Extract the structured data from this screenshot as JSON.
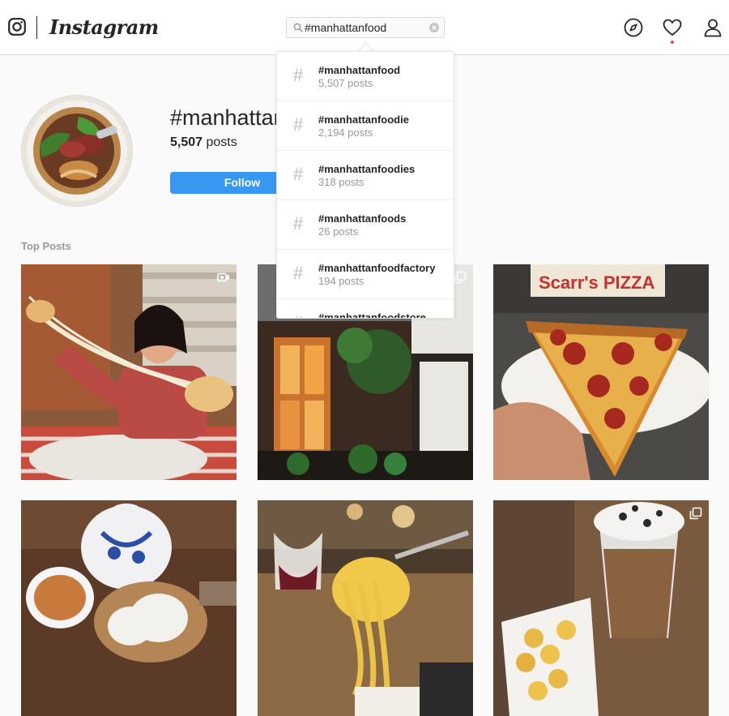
{
  "nav": {
    "wordmark": "Instagram",
    "search_value": "#manhattanfood",
    "icons": [
      "instagram-logo-icon",
      "search-icon",
      "clear-icon",
      "explore-compass-icon",
      "activity-heart-icon",
      "profile-person-icon"
    ],
    "notification_dot_color": "#ed4956"
  },
  "header": {
    "title": "#manhattanfood",
    "post_count": "5,507",
    "post_count_label": "posts",
    "follow_label": "Follow"
  },
  "section": {
    "top_posts_label": "Top Posts"
  },
  "search_results": [
    {
      "tag": "#manhattanfood",
      "count": "5,507 posts"
    },
    {
      "tag": "#manhattanfoodie",
      "count": "2,194 posts"
    },
    {
      "tag": "#manhattanfoodies",
      "count": "318 posts"
    },
    {
      "tag": "#manhattanfoods",
      "count": "26 posts"
    },
    {
      "tag": "#manhattanfoodfactory",
      "count": "194 posts"
    },
    {
      "tag": "#manhattanfoodstore",
      "count": ""
    }
  ],
  "hash_symbol": "#",
  "posts": [
    {
      "subject": "woman stretching cheesy bread",
      "badge": "video-icon"
    },
    {
      "subject": "restaurant storefront at dusk",
      "badge": "carousel-icon"
    },
    {
      "subject": "pepperoni pizza slice",
      "badge": "",
      "sign_text": "Scarr's PIZZA"
    },
    {
      "subject": "dim sum and teapot",
      "badge": ""
    },
    {
      "subject": "pasta with wine glass",
      "badge": ""
    },
    {
      "subject": "mac and cheese with shake",
      "badge": "carousel-icon"
    }
  ],
  "colors": {
    "accent": "#3897f0",
    "border": "#dbdbdb",
    "muted_text": "#999999",
    "background": "#fafafa"
  }
}
